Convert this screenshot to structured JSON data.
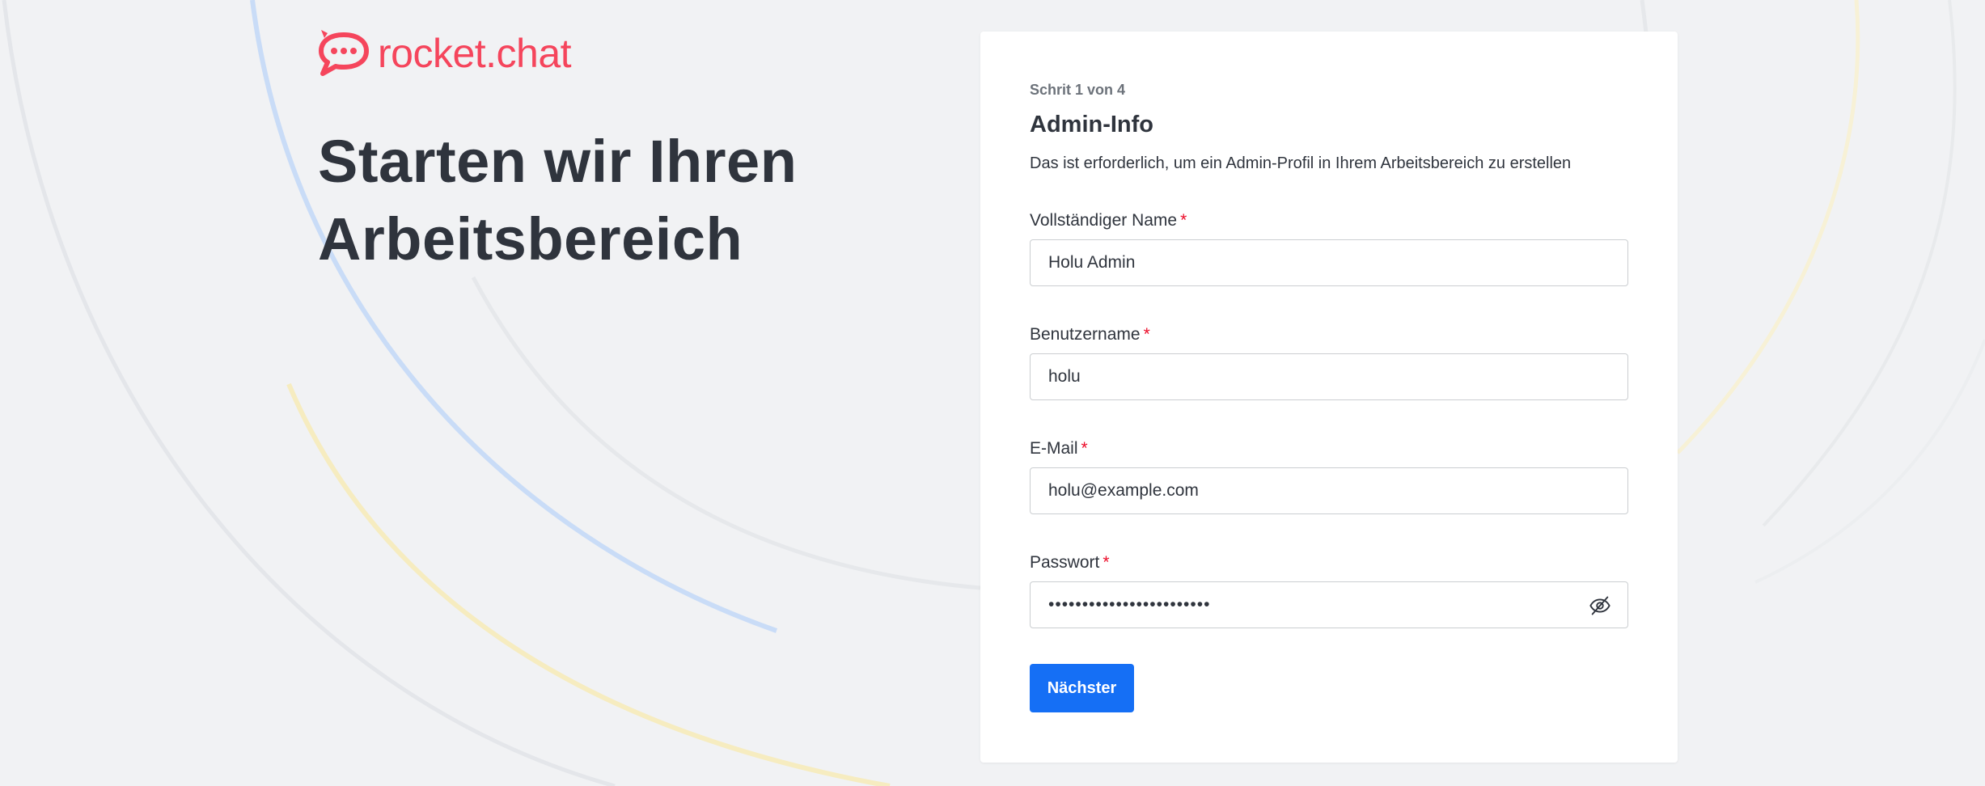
{
  "brand": {
    "logo_text": "rocket.chat",
    "color": "#f5455c"
  },
  "hero": {
    "line1": "Starten wir Ihren",
    "line2": "Arbeitsbereich"
  },
  "form": {
    "step": "Schrit 1 von 4",
    "title": "Admin-Info",
    "subtitle": "Das ist erforderlich, um ein Admin-Profil in Ihrem Arbeitsbereich zu erstellen",
    "required_marker": "*",
    "fields": {
      "fullname": {
        "label": "Vollständiger Name",
        "value": "Holu Admin"
      },
      "username": {
        "label": "Benutzername",
        "value": "holu"
      },
      "email": {
        "label": "E-Mail",
        "value": "holu@example.com"
      },
      "password": {
        "label": "Passwort",
        "value": "••••••••••••••••••••••••",
        "toggle_icon": "eye-off-icon"
      }
    },
    "next_label": "Nächster"
  },
  "colors": {
    "primary_button": "#156ff5",
    "required": "#ec0d2a",
    "text": "#2f343d",
    "background": "#f1f2f4"
  }
}
